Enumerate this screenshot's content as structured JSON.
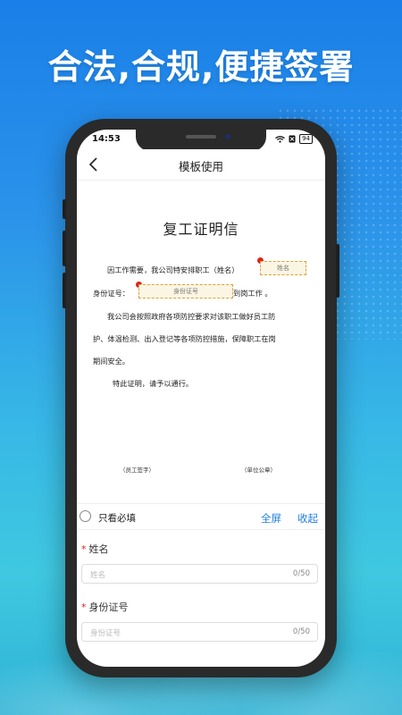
{
  "slogan": "合法,合规,便捷签署",
  "status": {
    "time": "14:53",
    "battery": "94"
  },
  "navbar": {
    "title": "模板使用"
  },
  "document": {
    "title": "复工证明信",
    "line1": "因工作需要，我公司特安排职工（姓名）",
    "name_field": "姓名",
    "line2_prefix": "身份证号：",
    "id_field": "身份证号",
    "line2_suffix": "到岗工作 。",
    "para2_line1": "我公司会按照政府各项防控要求对该职工做好员工防",
    "para2_line2": "护、体温检测、出入登记等各项防控措施，保障职工在岗",
    "para2_line3": "期间安全。",
    "para3": "特此证明，请予以通行。",
    "sign_left": "（员工签字）",
    "sign_right": "（单位公章）"
  },
  "toolbar": {
    "only_required": "只看必填",
    "fullscreen": "全屏",
    "collapse": "收起"
  },
  "form": {
    "fields": [
      {
        "label": "姓名",
        "required": "*",
        "placeholder": "姓名",
        "count": "0/50"
      },
      {
        "label": "身份证号",
        "required": "*",
        "placeholder": "身份证号",
        "count": "0/50"
      }
    ]
  },
  "colors": {
    "accent": "#1f7de0",
    "required": "#e0221b",
    "background_top": "#1a7fe8",
    "background_bottom": "#3fc8e0"
  }
}
